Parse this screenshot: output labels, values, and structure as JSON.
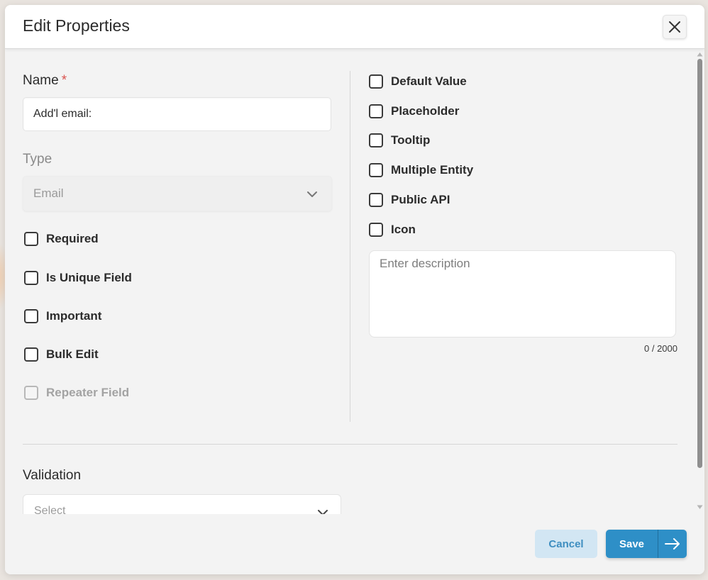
{
  "dialog": {
    "title": "Edit Properties"
  },
  "form": {
    "name_label": "Name",
    "required_star": "*",
    "name_value": "Add'l email:",
    "type_label": "Type",
    "type_value": "Email",
    "left_checkboxes": [
      {
        "label": "Required",
        "checked": false,
        "disabled": false
      },
      {
        "label": "Is Unique Field",
        "checked": false,
        "disabled": false
      },
      {
        "label": "Important",
        "checked": false,
        "disabled": false
      },
      {
        "label": "Bulk Edit",
        "checked": false,
        "disabled": false
      },
      {
        "label": "Repeater Field",
        "checked": false,
        "disabled": true
      }
    ],
    "right_checkboxes": [
      {
        "label": "Default Value",
        "checked": false
      },
      {
        "label": "Placeholder",
        "checked": false
      },
      {
        "label": "Tooltip",
        "checked": false
      },
      {
        "label": "Multiple Entity",
        "checked": false
      },
      {
        "label": "Public API",
        "checked": false
      },
      {
        "label": "Icon",
        "checked": false
      }
    ],
    "description_placeholder": "Enter description",
    "description_counter": "0 / 2000",
    "validation_label": "Validation",
    "validation_placeholder": "Select"
  },
  "footer": {
    "cancel_label": "Cancel",
    "save_label": "Save"
  },
  "colors": {
    "primary": "#2e8fc7",
    "cancel_bg": "#d2e6f3",
    "required_star": "#d9534f"
  },
  "icons": {
    "close": "close-icon",
    "chevron": "chevron-down-icon",
    "save_arrow": "arrow-right-icon"
  }
}
